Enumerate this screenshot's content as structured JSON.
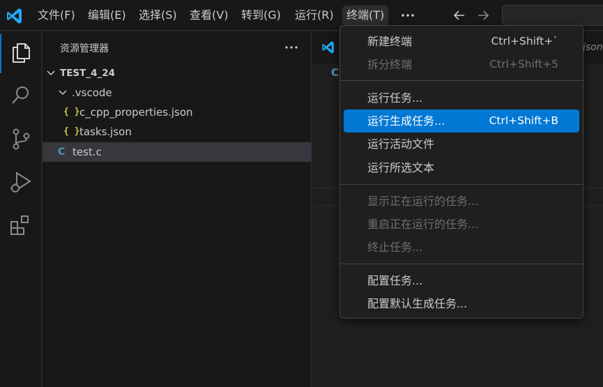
{
  "menubar": {
    "items": [
      "文件(F)",
      "编辑(E)",
      "选择(S)",
      "查看(V)",
      "转到(G)",
      "运行(R)",
      "终端(T)"
    ],
    "active_index": 6
  },
  "sidebar": {
    "title": "资源管理器",
    "tree": [
      {
        "label": "TEST_4_24",
        "kind": "root-folder",
        "expanded": true
      },
      {
        "label": ".vscode",
        "kind": "folder",
        "expanded": true
      },
      {
        "label": "c_cpp_properties.json",
        "kind": "json",
        "icon_glyph": "{ }"
      },
      {
        "label": "tasks.json",
        "kind": "json",
        "icon_glyph": "{ }"
      },
      {
        "label": "test.c",
        "kind": "c",
        "icon_glyph": "C",
        "selected": true
      }
    ]
  },
  "editor": {
    "tab_partial_ext": "json",
    "breadcrumb_icon": "C"
  },
  "terminal_menu": {
    "groups": [
      [
        {
          "label": "新建终端",
          "shortcut": "Ctrl+Shift+`",
          "disabled": false
        },
        {
          "label": "拆分终端",
          "shortcut": "Ctrl+Shift+5",
          "disabled": true
        }
      ],
      [
        {
          "label": "运行任务...",
          "shortcut": "",
          "disabled": false
        },
        {
          "label": "运行生成任务...",
          "shortcut": "Ctrl+Shift+B",
          "disabled": false,
          "highlighted": true
        },
        {
          "label": "运行活动文件",
          "shortcut": "",
          "disabled": false
        },
        {
          "label": "运行所选文本",
          "shortcut": "",
          "disabled": false
        }
      ],
      [
        {
          "label": "显示正在运行的任务...",
          "shortcut": "",
          "disabled": true
        },
        {
          "label": "重启正在运行的任务...",
          "shortcut": "",
          "disabled": true
        },
        {
          "label": "终止任务...",
          "shortcut": "",
          "disabled": true
        }
      ],
      [
        {
          "label": "配置任务...",
          "shortcut": "",
          "disabled": false
        },
        {
          "label": "配置默认生成任务...",
          "shortcut": "",
          "disabled": false
        }
      ]
    ]
  },
  "colors": {
    "accent": "#0078d4",
    "json_icon": "#cbcb41",
    "c_icon": "#519aba",
    "vscode_logo": "#23a9f2"
  }
}
